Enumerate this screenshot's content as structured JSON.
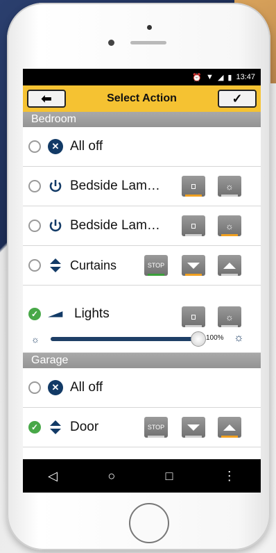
{
  "status": {
    "time": "13:47"
  },
  "topbar": {
    "back_symbol": "⬅",
    "title": "Select Action",
    "confirm_symbol": "✓"
  },
  "sections": [
    {
      "name": "Bedroom"
    },
    {
      "name": "Garage"
    }
  ],
  "bedroom": {
    "all_off": "All off",
    "lamp1": "Bedside Lam…",
    "lamp2": "Bedside Lam…",
    "curtains": "Curtains",
    "stop": "STOP",
    "lights": "Lights",
    "lights_level_label": "100%",
    "lights_level": 1.0
  },
  "garage": {
    "all_off": "All off",
    "door": "Door",
    "stop": "STOP"
  },
  "colors": {
    "accent": "#f5c232",
    "brand": "#123a66",
    "selected": "#48a848",
    "button_active": "#f0a020"
  }
}
